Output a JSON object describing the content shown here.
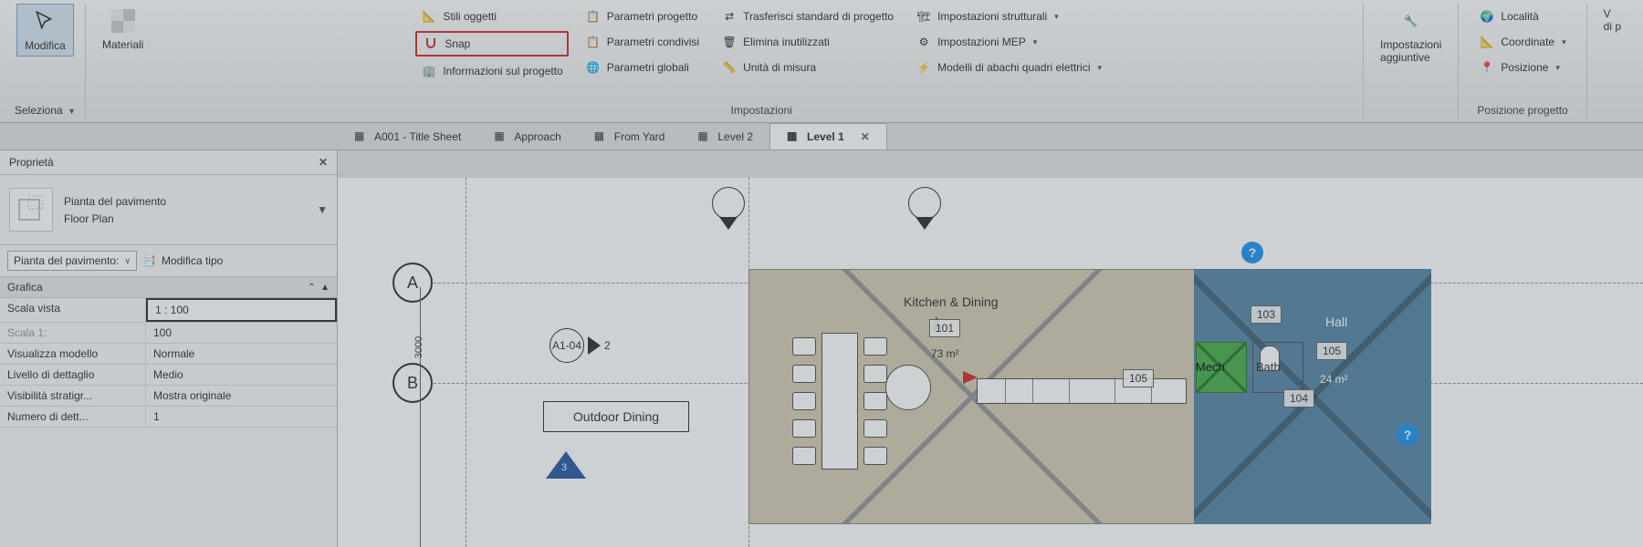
{
  "ribbon": {
    "seleziona": {
      "modifica": "Modifica",
      "panel": "Seleziona"
    },
    "materiali": "Materiali",
    "col1": {
      "stili": "Stili oggetti",
      "snap": "Snap",
      "info": "Informazioni sul progetto"
    },
    "col2": {
      "p_prog": "Parametri progetto",
      "p_cond": "Parametri condivisi",
      "p_glob": "Parametri  globali"
    },
    "col3": {
      "trasf": "Trasferisci standard di progetto",
      "elim": "Elimina inutilizzati",
      "unita": "Unità di misura"
    },
    "impostazioni_panel": "Impostazioni",
    "col4": {
      "strutt": "Impostazioni strutturali",
      "mep": "Impostazioni MEP",
      "abachi": "Modelli di abachi quadri elettrici"
    },
    "agg": {
      "top": "Impostazioni",
      "bot": "aggiuntive"
    },
    "col5": {
      "loc": "Località",
      "coord": "Coordinate",
      "pos": "Posizione"
    },
    "pos_panel": "Posizione progetto",
    "last": "V\ndi p"
  },
  "tabs": [
    {
      "label": "A001 - Title Sheet",
      "active": false
    },
    {
      "label": "Approach",
      "active": false
    },
    {
      "label": "From Yard",
      "active": false
    },
    {
      "label": "Level 2",
      "active": false
    },
    {
      "label": "Level 1",
      "active": true
    }
  ],
  "props": {
    "title": "Proprietà",
    "type_l1": "Pianta del pavimento",
    "type_l2": "Floor Plan",
    "filter": "Pianta del pavimento:",
    "edit_type": "Modifica tipo",
    "cat": "Grafica",
    "rows": [
      {
        "k": "Scala vista",
        "v": "1 : 100",
        "sel": true
      },
      {
        "k": "Scala  1:",
        "v": "100",
        "dis": true
      },
      {
        "k": "Visualizza modello",
        "v": "Normale"
      },
      {
        "k": "Livello di dettaglio",
        "v": "Medio"
      },
      {
        "k": "Visibilità stratigr...",
        "v": "Mostra originale"
      },
      {
        "k": "Numero di dett...",
        "v": "1"
      }
    ]
  },
  "canvas": {
    "gridA": "A",
    "gridB": "B",
    "dim": "3000",
    "sect": "A1-04",
    "sect_n": "2",
    "outdoor": "Outdoor Dining",
    "kd": "Kitchen & Dining",
    "rm101": "101",
    "area101": "73 m²",
    "rm103": "103",
    "rm104": "104",
    "rm105": "105",
    "rm105b": "105",
    "mech": "Mech",
    "bath": "Bath",
    "hall": "Hall",
    "hall_area": "24 m²",
    "tri_n": "3"
  }
}
